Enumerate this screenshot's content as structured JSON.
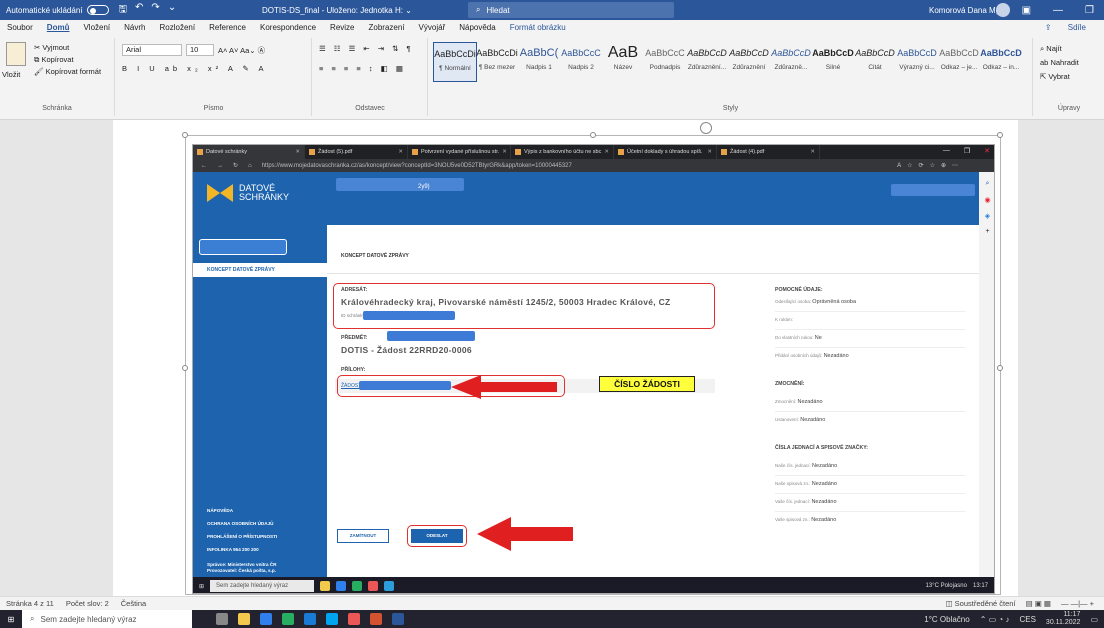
{
  "word": {
    "autosave": "Automatické ukládání",
    "doc_title": "DOTIS-DS_final - Uloženo: Jednotka H: ⌄",
    "search": "Hledat",
    "user": "Komorová Dana Mgr.",
    "tabs": [
      "Soubor",
      "Domů",
      "Vložení",
      "Návrh",
      "Rozložení",
      "Reference",
      "Korespondence",
      "Revize",
      "Zobrazení",
      "Vývojář",
      "Nápověda",
      "Formát obrázku"
    ],
    "share": "Sdíle",
    "clipboard": {
      "paste": "Vložit",
      "cut": "Vyjmout",
      "copy": "Kopírovat",
      "format": "Kopírovat formát",
      "label": "Schránka"
    },
    "font": {
      "name": "Arial",
      "size": "10",
      "label": "Písmo"
    },
    "para_label": "Odstavec",
    "styles_label": "Styly",
    "styles": [
      {
        "sample": "AaBbCcDi",
        "name": "¶ Normální"
      },
      {
        "sample": "AaBbCcDi",
        "name": "¶ Bez mezer"
      },
      {
        "sample": "AaBbC(",
        "name": "Nadpis 1"
      },
      {
        "sample": "AaBbCcC",
        "name": "Nadpis 2"
      },
      {
        "sample": "AaB",
        "name": "Název"
      },
      {
        "sample": "AaBbCcC",
        "name": "Podnadpis"
      },
      {
        "sample": "AaBbCcD",
        "name": "Zdůraznění..."
      },
      {
        "sample": "AaBbCcD",
        "name": "Zdůraznění"
      },
      {
        "sample": "AaBbCcD",
        "name": "Zdůrazně..."
      },
      {
        "sample": "AaBbCcD",
        "name": "Silné"
      },
      {
        "sample": "AaBbCcD",
        "name": "Citát"
      },
      {
        "sample": "AaBbCcD",
        "name": "Výrazný ci..."
      },
      {
        "sample": "AaBbCcD",
        "name": "Odkaz – je..."
      },
      {
        "sample": "AaBbCcD",
        "name": "Odkaz – in..."
      }
    ],
    "edit": {
      "find": "Najít",
      "replace": "Nahradit",
      "select": "Vybrat",
      "label": "Úpravy"
    },
    "status": {
      "page": "Stránka 4 z 11",
      "words": "Počet slov: 2",
      "lang": "Čeština",
      "focus": "Soustředěné čtení"
    }
  },
  "browser": {
    "tabs": [
      "Datové schránky",
      "Žádost (5).pdf",
      "Potvrzení vydané příslušnou str.",
      "Výpis z bankovního účtu ne sbc",
      "Účetní doklady s úhradou spíš.",
      "Žádost (4).pdf"
    ],
    "url": "https://www.mojedatovaschranka.cz/as/koncept/view?conceptId=3NOU5ve0D52TBtyrGRk&app/token=10000445327",
    "site": {
      "logo_line1": "DATOVÉ",
      "logo_line2": "SCHRÁNKY",
      "head_code": "2y9)",
      "nav_selected": "KONCEPT DATOVÉ ZPRÁVY",
      "sidebar_footer": [
        "NÁPOVĚDA",
        "OCHRANA OSOBNÍCH ÚDAJŮ",
        "PROHLÁŠENÍ O PŘÍSTUPNOSTI",
        "INFOLINKA 954 200 200"
      ],
      "sidebar_small_1": "Správce: Ministerstvo vnitra ČR",
      "sidebar_small_2": "Provozovatel: Česká pošta, s.p.",
      "crumb": "KONCEPT DATOVÉ ZPRÁVY",
      "adresat_label": "ADRESÁT:",
      "adresat_value": "Královéhradecký kraj, Pivovarské náměstí 1245/2, 50003 Hradec Králové, CZ",
      "id_schranky": "ID schránky:",
      "predmet_label": "PŘEDMĚT:",
      "predmet_value": "DOTIS - Žádost 22RRD20-0006",
      "prilohy_label": "PŘÍLOHY:",
      "attachment_link": "ŽÁDOST",
      "attachment_size": "(319,28 kB)",
      "callout": "ČÍSLO ŽÁDOSTI",
      "btn_discard": "ZAMÍTNOUT",
      "btn_send": "ODESLAT",
      "right": {
        "h_pomocne": "POMOCNÉ ÚDAJE:",
        "odesilajici_label": "Odesílající osoba:",
        "odesilajici_value": "Oprávněná osoba",
        "k_rukam": "K rukám:",
        "do_vlastnich_label": "Do vlastních rukou:",
        "do_vlastnich_value": "Ne",
        "prilozeni_label": "Přidání osobních údajů:",
        "prilozeni_value": "Nezadáno",
        "h_zmocneni": "ZMOCNĚNÍ:",
        "zmocneni_label": "Zmocnění:",
        "zmocneni_value": "Nezadáno",
        "ustanoveni_label": "Ustanovení:",
        "ustanoveni_value": "Nezadáno",
        "h_cisla": "ČÍSLA JEDNACÍ A SPISOVÉ ZNAČKY:",
        "rows": [
          {
            "label": "Naše čís. jednací:",
            "value": "Nezadáno"
          },
          {
            "label": "Naše spisová zn.:",
            "value": "Nezadáno"
          },
          {
            "label": "Vaše čís. jednací:",
            "value": "Nezadáno"
          },
          {
            "label": "Vaše spisová zn.:",
            "value": "Nezadáno"
          }
        ]
      }
    },
    "inner_task_search": "Sem zadejte hledaný výraz",
    "inner_weather": "13°C Polojasno",
    "inner_time": "13:17"
  },
  "taskbar": {
    "search": "Sem zadejte hledaný výraz",
    "weather": "1°C Oblačno",
    "lang": "CES",
    "time": "11:17",
    "date": "30.11.2022"
  },
  "colors": {
    "word_blue": "#2b579a",
    "ds_blue": "#1d63ad",
    "callout_yellow": "#ffff3b",
    "annotation_red": "#e03030"
  }
}
